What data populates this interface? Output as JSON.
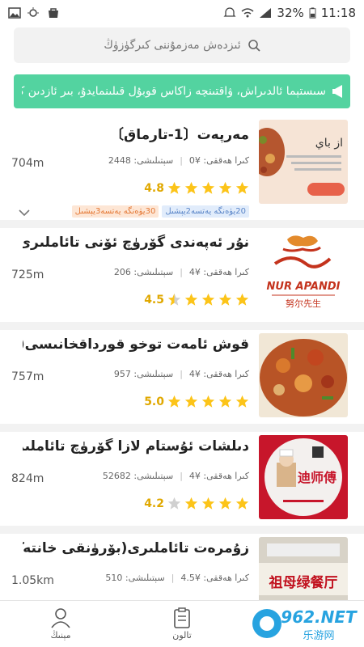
{
  "status_bar": {
    "battery": "32%",
    "time": "11:18"
  },
  "search": {
    "placeholder": "ئىزدەش مەزمۇننى كىرگۈزۈڭ"
  },
  "banner": {
    "text": "سىستېما ئالدىراش، ۋاقتىنچە زاكاس قوبۇل قىلىنمايدۇ، بىر ئازدىن كې"
  },
  "restaurants": [
    {
      "name": "مەرپەت〔1-تارماق〕",
      "distance": "704m",
      "sales": "سېتىلىشى: 2448",
      "price": "كىرا ھەققى: ¥0",
      "rating": "4.8",
      "stars": 5,
      "tags": [
        "20يۈەنگە يەتسە2يېشىل",
        "30يۈەنگە يەتسە3يېشىل"
      ],
      "thumb_text": "از باي",
      "thumb_colors": [
        "#f6e4d6",
        "#e7614a"
      ]
    },
    {
      "name": "نۇر ئەپەندى گۆرۈچ ئۆنى تائاملىرى",
      "distance": "725m",
      "sales": "سېتىلىشى: 206",
      "price": "كىرا ھەققى: ¥4",
      "rating": "4.5",
      "stars": 4.5,
      "logo_text": "NUR APANDI",
      "logo_cn": "努尔先生"
    },
    {
      "name": "قوش ئامەت توخو قورداقخانىسى(كونسول ...",
      "distance": "757m",
      "sales": "سېتىلىشى: 957",
      "price": "كىرا ھەققى: ¥4",
      "rating": "5.0",
      "stars": 5
    },
    {
      "name": "دىلشات ئۇستام لازا گۆرۈچ تائاملىرى (ب..",
      "distance": "824m",
      "sales": "سېتىلىشى: 52682",
      "price": "كىرا ھەققى: ¥4",
      "rating": "4.2",
      "stars": 4,
      "logo_cn": "迪师傅"
    },
    {
      "name": "زۇمرەت تائاملىرى(بۆرۈنقى خانتەڭرى)",
      "distance": "1.05km",
      "sales": "سېتىلىشى: 510",
      "price": "كىرا ھەققى: ¥4.5",
      "rating": "",
      "stars": 0,
      "logo_cn": "祖母绿餐厅"
    }
  ],
  "bottom_nav": {
    "home_label": "مېنىڭ",
    "coupon_label": "تالون"
  },
  "watermark": {
    "text": "962.NET",
    "sub": "乐游网"
  },
  "colors": {
    "accent": "#53d3a0",
    "star": "#fcc419",
    "star_empty": "#d0d0d0"
  }
}
